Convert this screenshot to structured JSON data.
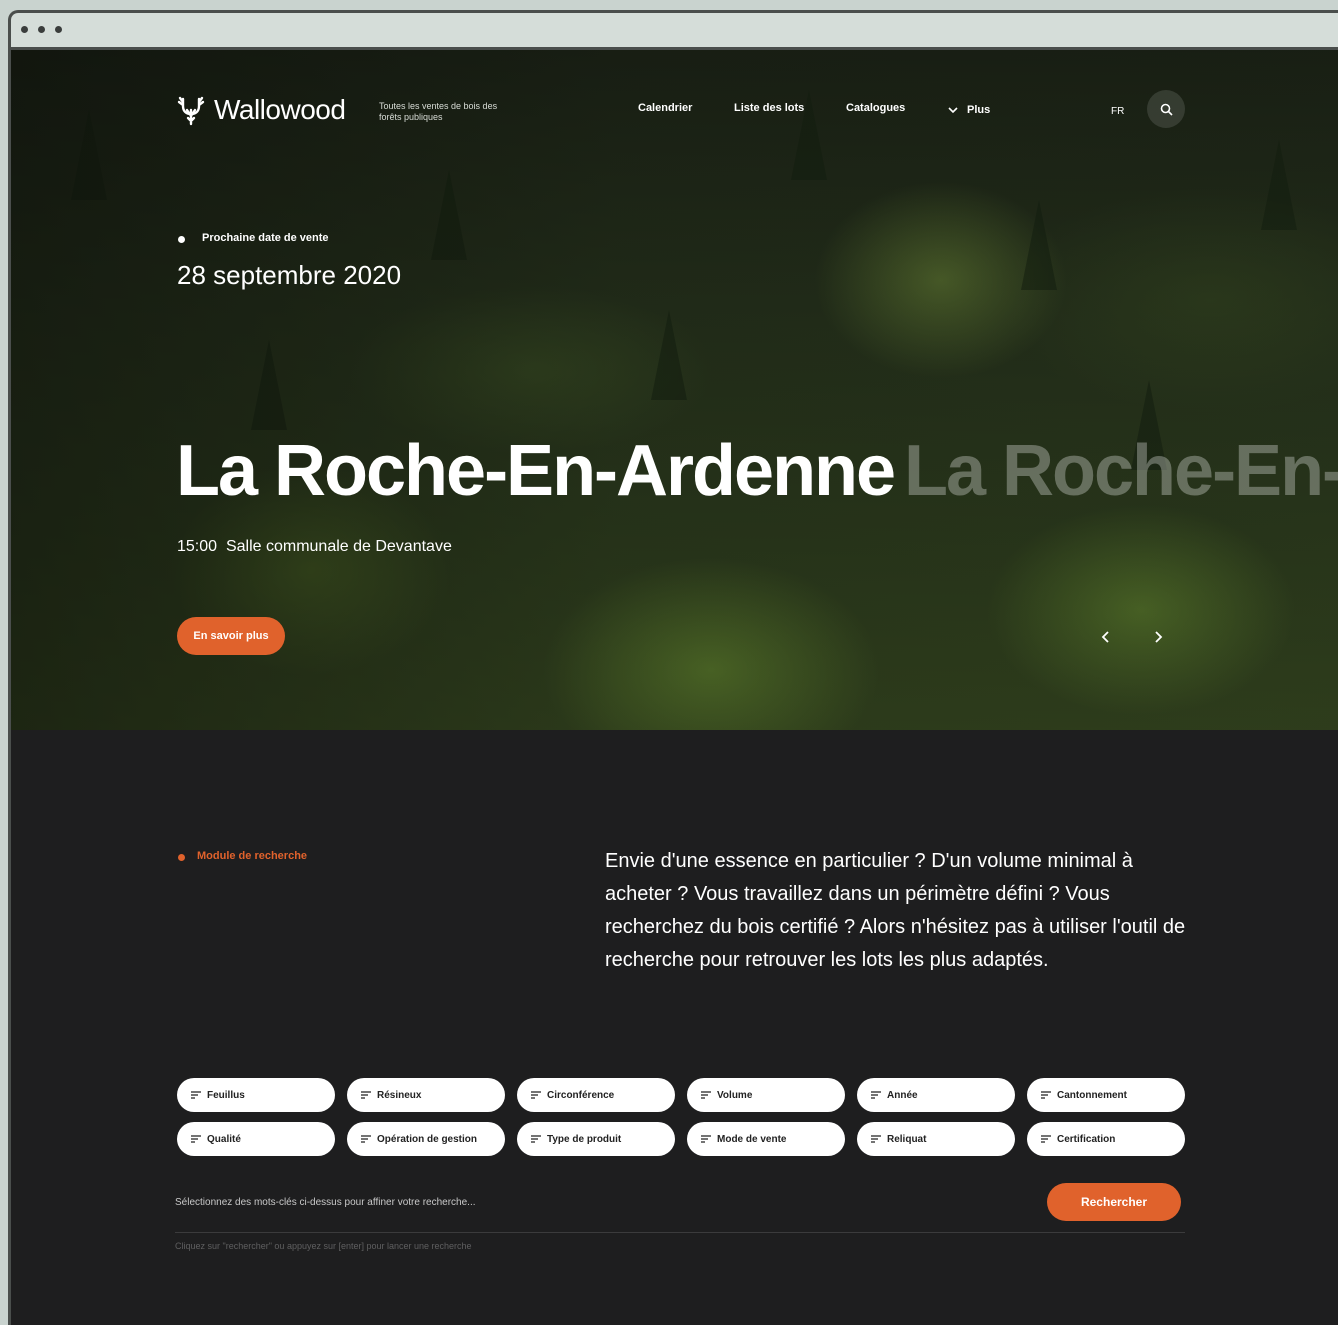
{
  "header": {
    "brand": "Wallowood",
    "tagline": "Toutes les ventes de bois des forêts publiques",
    "nav": [
      "Calendrier",
      "Liste des lots",
      "Catalogues"
    ],
    "more_label": "Plus",
    "language": "FR",
    "icons": {
      "logo": "deer-antler-logo-icon",
      "search": "search-icon",
      "more": "chevron-down-icon"
    }
  },
  "hero": {
    "next_sale_label": "Prochaine date de vente",
    "next_sale_date": "28 septembre 2020",
    "title": "La Roche-En-Ardenne",
    "title_ghost": "La Roche-En-",
    "time": "15:00",
    "location": "Salle communale de Devantave",
    "cta_label": "En savoir plus",
    "prev_icon": "chevron-left-icon",
    "next_icon": "chevron-right-icon"
  },
  "search": {
    "section_label": "Module de recherche",
    "intro": "Envie d'une essence en particulier ? D'un volume minimal à acheter ? Vous travaillez dans un périmètre défini ? Vous recherchez du bois certifié ? Alors n'hésitez pas à utiliser l'outil de recherche pour retrouver les lots les plus adaptés.",
    "filters": [
      "Feuillus",
      "Résineux",
      "Circonférence",
      "Volume",
      "Année",
      "Cantonnement",
      "Qualité",
      "Opération de gestion",
      "Type de produit",
      "Mode de vente",
      "Reliquat",
      "Certification"
    ],
    "filter_icon": "filter-lines-icon",
    "hint": "Sélectionnez des mots-clés ci-dessus pour affiner votre recherche...",
    "submit_label": "Rechercher",
    "subhint": "Cliquez sur \"rechercher\" ou appuyez sur [enter] pour lancer une recherche"
  },
  "colors": {
    "accent": "#e0622c",
    "background": "#1e1e1f"
  }
}
